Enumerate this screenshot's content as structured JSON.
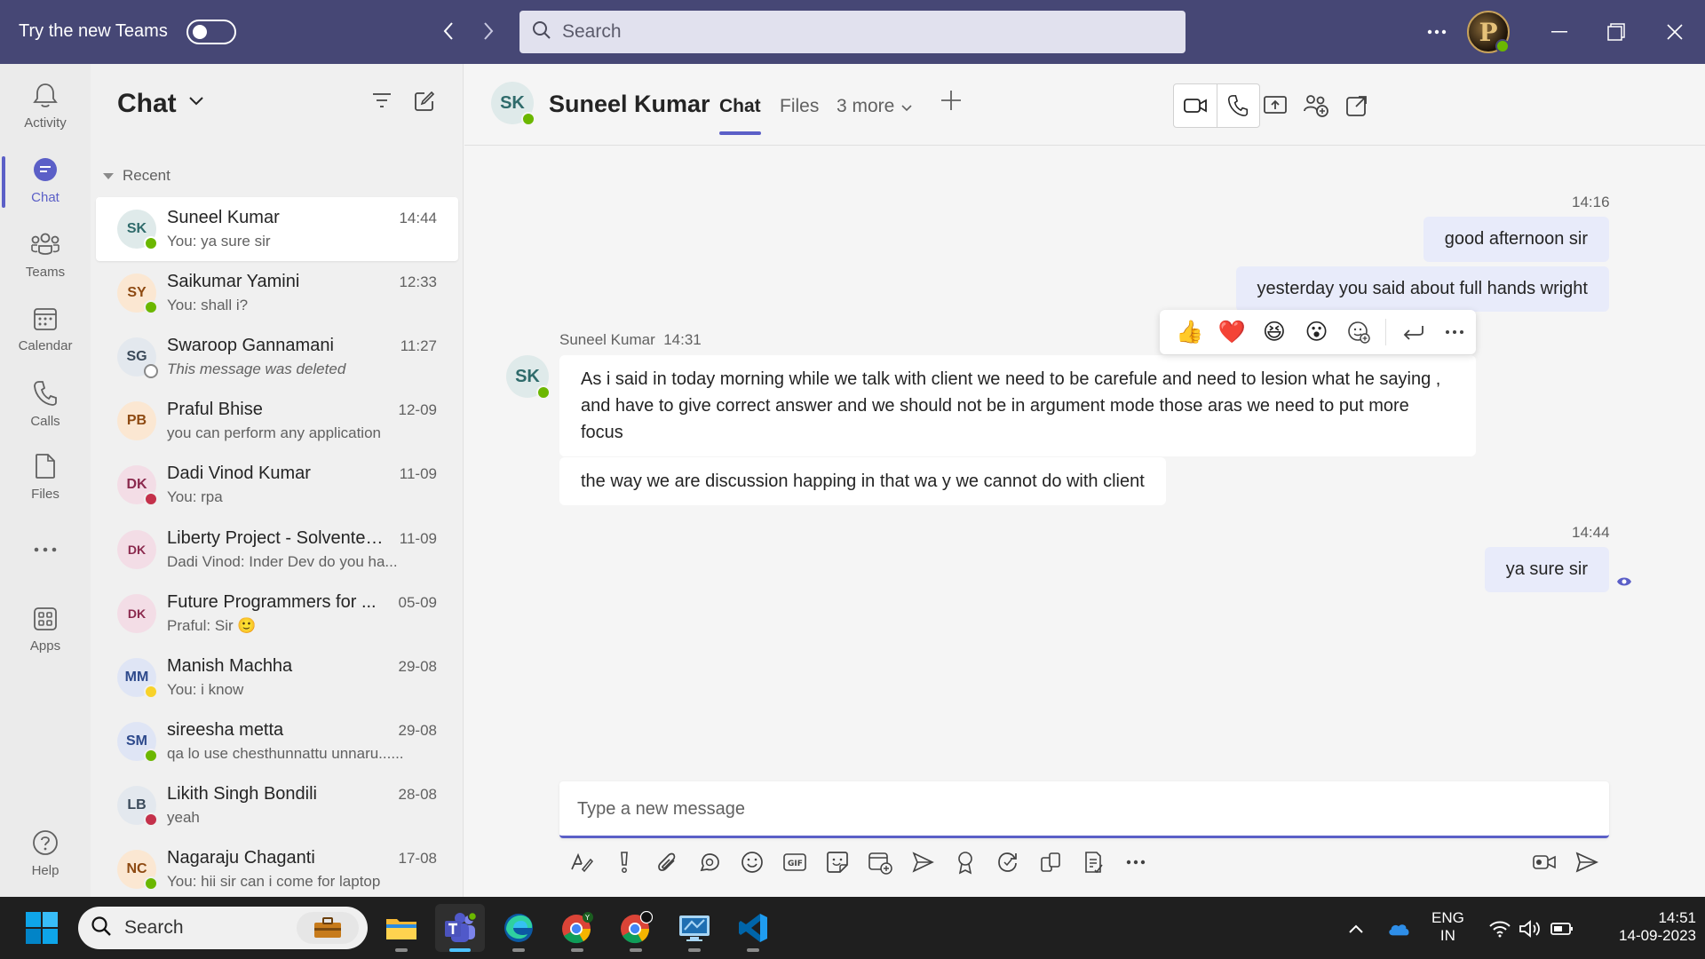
{
  "titlebar": {
    "try_new_label": "Try the new Teams",
    "search_placeholder": "Search",
    "profile_initial": "P"
  },
  "rail": {
    "items": [
      {
        "label": "Activity",
        "icon": "bell-icon"
      },
      {
        "label": "Chat",
        "icon": "chat-icon"
      },
      {
        "label": "Teams",
        "icon": "teams-icon"
      },
      {
        "label": "Calendar",
        "icon": "calendar-icon"
      },
      {
        "label": "Calls",
        "icon": "phone-icon"
      },
      {
        "label": "Files",
        "icon": "file-icon"
      },
      {
        "label": "",
        "icon": "more-icon"
      },
      {
        "label": "Apps",
        "icon": "apps-icon"
      }
    ],
    "help_label": "Help",
    "active": "Chat"
  },
  "chatlist": {
    "title": "Chat",
    "section": "Recent",
    "chats": [
      {
        "initials": "SK",
        "name": "Suneel Kumar",
        "time": "14:44",
        "preview": "You: ya sure sir",
        "status": "available",
        "bg": "#dfeaea",
        "fg": "#2f6b6b"
      },
      {
        "initials": "SY",
        "name": "Saikumar Yamini",
        "time": "12:33",
        "preview": "You: shall i?",
        "status": "available",
        "bg": "#fbe7d2",
        "fg": "#8e4a12"
      },
      {
        "initials": "SG",
        "name": "Swaroop Gannamani",
        "time": "11:27",
        "preview": "This message was deleted",
        "status": "offline",
        "bg": "#e3e8ee",
        "fg": "#3b4a5a"
      },
      {
        "initials": "PB",
        "name": "Praful Bhise",
        "time": "12-09",
        "preview": "you can perform any application",
        "status": "none",
        "bg": "#fbe7d2",
        "fg": "#8e4a12"
      },
      {
        "initials": "DK",
        "name": "Dadi Vinod Kumar",
        "time": "11-09",
        "preview": "You: rpa",
        "status": "busy",
        "bg": "#f3dde6",
        "fg": "#8b2a4e"
      },
      {
        "initials": "DK",
        "name": "Liberty Project - Solventek...",
        "time": "11-09",
        "preview": "Dadi Vinod: Inder Dev do you ha...",
        "status": "group",
        "bg": "#f3dde6",
        "fg": "#8b2a4e"
      },
      {
        "initials": "DK",
        "name": "Future Programmers for ...",
        "time": "05-09",
        "preview": "Praful: Sir 🙂",
        "status": "group",
        "bg": "#f3dde6",
        "fg": "#8b2a4e"
      },
      {
        "initials": "MM",
        "name": "Manish Machha",
        "time": "29-08",
        "preview": "You: i know",
        "status": "away",
        "bg": "#dfe5f5",
        "fg": "#2e4a8c"
      },
      {
        "initials": "SM",
        "name": "sireesha metta",
        "time": "29-08",
        "preview": "qa lo use chesthunnattu unnaru......",
        "status": "available",
        "bg": "#dfe5f5",
        "fg": "#2e4a8c"
      },
      {
        "initials": "LB",
        "name": "Likith Singh Bondili",
        "time": "28-08",
        "preview": "yeah",
        "status": "dnd",
        "bg": "#e3e8ee",
        "fg": "#3b4a5a"
      },
      {
        "initials": "NC",
        "name": "Nagaraju Chaganti",
        "time": "17-08",
        "preview": "You: hii sir can i come for laptop",
        "status": "available",
        "bg": "#fbe7d2",
        "fg": "#8e4a12"
      }
    ]
  },
  "header": {
    "initials": "SK",
    "name": "Suneel Kumar",
    "tabs": [
      "Chat",
      "Files",
      "3 more"
    ],
    "active_tab": "Chat"
  },
  "messages": {
    "m1_time": "14:16",
    "m1_text": "good afternoon sir",
    "m2_text": "yesterday you said about full hands wright",
    "sender_name": "Suneel Kumar",
    "sender_time": "14:31",
    "sender_initials": "SK",
    "m3_text": "As i said in today morning while we talk with client we need to be carefule and need to lesion what he saying , and have to give correct answer and we should not be in argument mode those aras we need to put more focus",
    "m4_text": "the way we are discussion happing in that wa y we cannot do with client",
    "m5_time": "14:44",
    "m5_text": "ya sure sir",
    "reactions": [
      "👍",
      "❤️",
      "😆",
      "😮"
    ]
  },
  "compose": {
    "placeholder": "Type a new message"
  },
  "taskbar": {
    "search_placeholder": "Search",
    "lang_top": "ENG",
    "lang_bottom": "IN",
    "time": "14:51",
    "date": "14-09-2023"
  }
}
